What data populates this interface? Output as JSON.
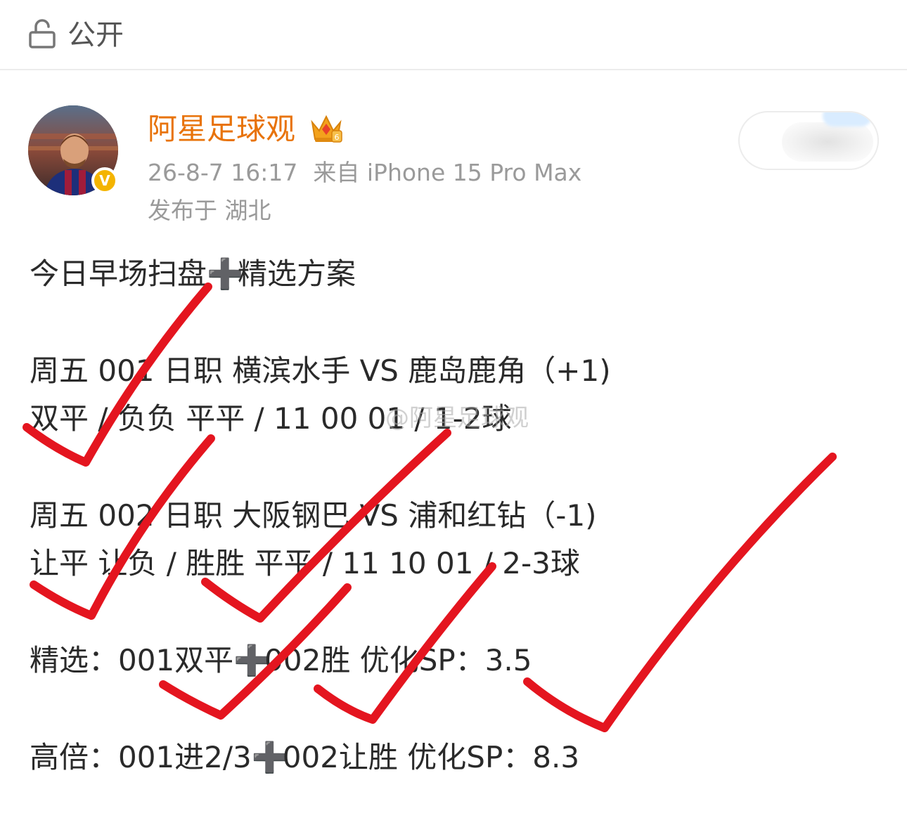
{
  "header": {
    "visibility_label": "公开",
    "lock_icon": "lock-open-icon"
  },
  "author": {
    "name": "阿星足球观",
    "badge_icon": "crown-icon",
    "verified_icon": "verified-v-icon",
    "verified_mark": "V",
    "timestamp": "26-8-7 16:17",
    "source": "来自 iPhone 15 Pro Max",
    "location": "发布于 湖北"
  },
  "post": {
    "title_a": "今日早场扫盘",
    "title_b": "精选方案",
    "match1_header": "周五 001 日职 横滨水手 VS 鹿岛鹿角（+1)",
    "match1_picks": "双平 / 负负 平平 / 11 00 01 / 1-2球",
    "match2_header": "周五 002 日职 大阪钢巴 VS 浦和红钻（-1)",
    "match2_picks": "让平 让负 / 胜胜 平平 / 11 10 01 / 2-3球",
    "selected_a": "精选：001双平",
    "selected_b": "002胜  优化SP：3.5",
    "high_a": "高倍：001进2/3",
    "high_b": "002让胜  优化SP：8.3",
    "plus_symbol": "➕",
    "watermark": "@阿星足球观"
  },
  "colors": {
    "username": "#e8730a",
    "meta_text": "#9a9a9a",
    "check_marks": "#e4151f",
    "body_text": "#2a2a2a"
  }
}
